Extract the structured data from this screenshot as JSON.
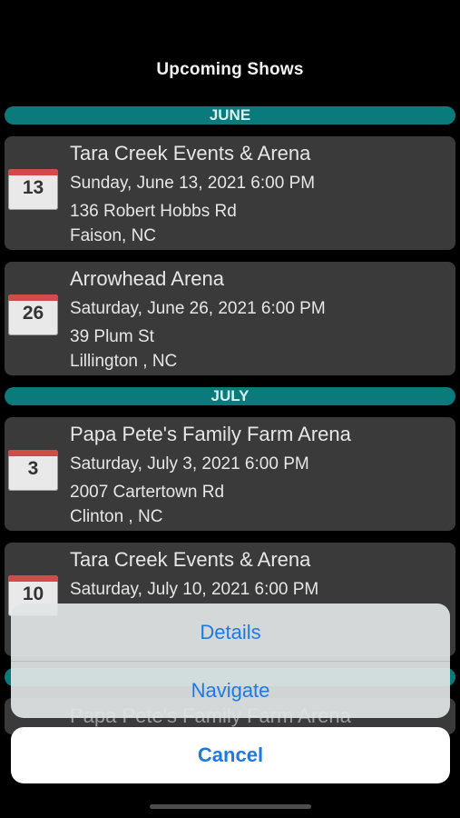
{
  "header": {
    "title": "Upcoming Shows"
  },
  "months": {
    "june": "JUNE",
    "july": "JULY"
  },
  "shows": [
    {
      "day": "13",
      "venue": "Tara Creek Events & Arena",
      "datetime": "Sunday, June 13, 2021 6:00 PM",
      "street": "136 Robert Hobbs Rd",
      "city": "Faison, NC"
    },
    {
      "day": "26",
      "venue": "Arrowhead Arena",
      "datetime": "Saturday, June 26, 2021 6:00 PM",
      "street": "39 Plum St",
      "city": "Lillington , NC"
    },
    {
      "day": "3",
      "venue": "Papa Pete's Family Farm Arena",
      "datetime": "Saturday, July 3, 2021 6:00 PM",
      "street": "2007 Cartertown Rd",
      "city": "Clinton , NC"
    },
    {
      "day": "10",
      "venue": "Tara Creek Events & Arena",
      "datetime": "Saturday, July 10, 2021 6:00 PM"
    }
  ],
  "partial_venue": "Papa Pete's Family Farm Arena",
  "action_sheet": {
    "details": "Details",
    "navigate": "Navigate",
    "cancel": "Cancel"
  },
  "colors": {
    "accent": "#1f7ae0",
    "month_bar": "#0b7a7a",
    "card": "#3a3a3a",
    "calendar_top": "#d24a4a"
  }
}
